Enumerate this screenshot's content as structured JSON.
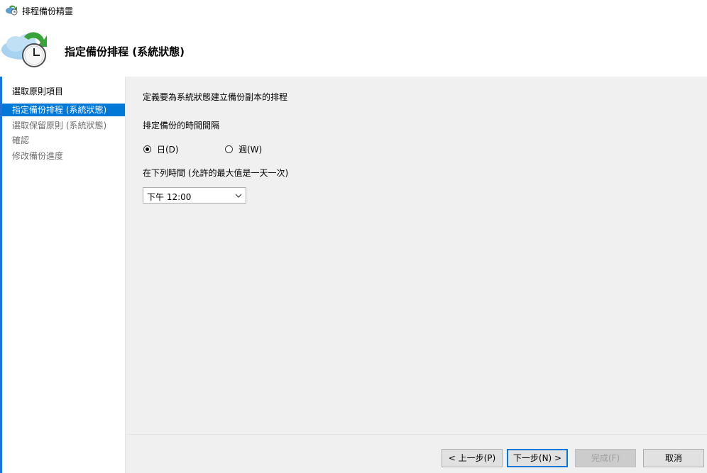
{
  "window": {
    "title": "排程備份精靈",
    "icon": "backup-schedule-icon"
  },
  "header": {
    "title": "指定備份排程 (系統狀態)",
    "icon": "cloud-clock-icon"
  },
  "sidebar": {
    "items": [
      {
        "label": "選取原則項目",
        "state": "normal"
      },
      {
        "label": "指定備份排程 (系統狀態)",
        "state": "active"
      },
      {
        "label": "選取保留原則 (系統狀態)",
        "state": "muted"
      },
      {
        "label": "確認",
        "state": "muted"
      },
      {
        "label": "修改備份進度",
        "state": "muted"
      }
    ]
  },
  "main": {
    "description": "定義要為系統狀態建立備份副本的排程",
    "interval_label": "排定備份的時間間隔",
    "radios": [
      {
        "label": "日(D)",
        "checked": true
      },
      {
        "label": "週(W)",
        "checked": false
      }
    ],
    "time_label": "在下列時間 (允許的最大值是一天一次)",
    "time_select": {
      "value": "下午 12:00"
    }
  },
  "footer": {
    "back_label": "< 上一步(P)",
    "next_label": "下一步(N) >",
    "finish_label": "完成(F)",
    "cancel_label": "取消"
  },
  "colors": {
    "accent": "#0078d7",
    "panel_bg": "#f0f0f0",
    "muted_text": "#6d6d6d"
  }
}
